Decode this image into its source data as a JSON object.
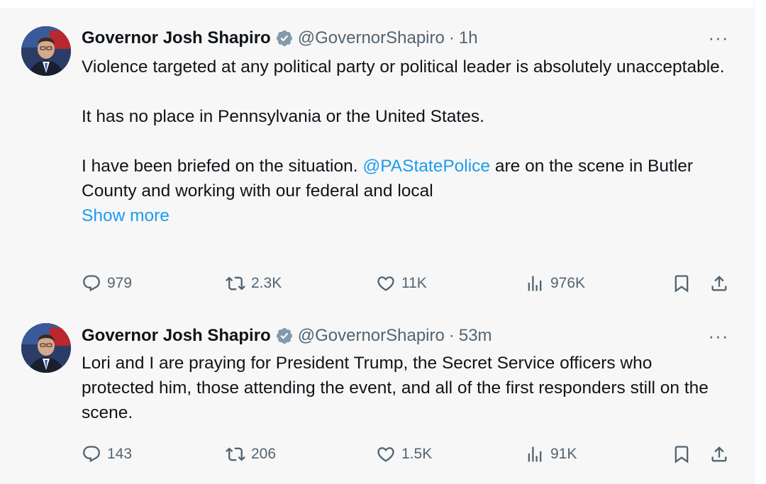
{
  "tweets": [
    {
      "name": "Governor Josh Shapiro",
      "handle": "@GovernorShapiro",
      "separator": "·",
      "time": "1h",
      "more": "···",
      "text": {
        "line1": "Violence targeted at any political party or political leader is absolutely unacceptable.",
        "line2": "It has no place in Pennsylvania or the United States.",
        "line3_pre": "I have been briefed on the situation. ",
        "mention": "@PAStatePolice",
        "line3_post": " are on the scene in Butler County and working with our federal and local",
        "show_more": "Show more"
      },
      "stats": {
        "replies": "979",
        "reposts": "2.3K",
        "likes": "11K",
        "views": "976K"
      }
    },
    {
      "name": "Governor Josh Shapiro",
      "handle": "@GovernorShapiro",
      "separator": "·",
      "time": "53m",
      "more": "···",
      "text": {
        "line1": "Lori and I are praying for President Trump, the Secret Service officers who protected him, those attending the event, and all of the first responders still on the scene."
      },
      "stats": {
        "replies": "143",
        "reposts": "206",
        "likes": "1.5K",
        "views": "91K"
      }
    }
  ],
  "icons": {
    "verified": "verified-badge-icon",
    "reply": "reply-icon",
    "repost": "repost-icon",
    "like": "heart-icon",
    "views": "views-chart-icon",
    "bookmark": "bookmark-icon",
    "share": "share-icon"
  },
  "colors": {
    "link": "#1d9bf0",
    "secondary_text": "#536471",
    "verified_badge": "#829aab",
    "tweet_background": "#f7f7f7"
  }
}
